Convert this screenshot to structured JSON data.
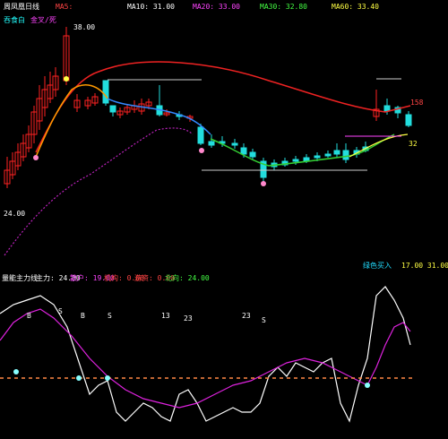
{
  "header": {
    "title": "周凤凰日线",
    "items": [
      {
        "text": "MA5:",
        "color": "#ff4444"
      },
      {
        "text": "MA10: 31.00",
        "color": "#ffffff"
      },
      {
        "text": "MA20: 33.00",
        "color": "#ff44ff"
      },
      {
        "text": "MA30: 32.80",
        "color": "#44ff44"
      },
      {
        "text": "MA60: 33.40",
        "color": "#ffff44"
      }
    ]
  },
  "sub_header": {
    "left_label": "吞食白",
    "badge": "金叉/死",
    "badge_color": "#ff44ff"
  },
  "price_labels": {
    "high": "38.00",
    "low": "24.00",
    "right_high": "158",
    "right_low": "32"
  },
  "indicator": {
    "title": "量能主力线",
    "items": [
      {
        "text": "主力: 24.00",
        "color": "#ffffff"
      },
      {
        "text": "散户: 19.00",
        "color": "#ff44ff"
      },
      {
        "text": "机构: 0.00",
        "color": "#ff4444"
      },
      {
        "text": "游资: 0.00",
        "color": "#ff4444"
      },
      {
        "text": "北向: 24.00",
        "color": "#44ff44"
      }
    ],
    "right_label": "绿色买入",
    "right_values": "17.00  31.00",
    "marks": [
      "B",
      "S",
      "B",
      "S",
      "13",
      "23",
      "23",
      "S"
    ]
  },
  "colors": {
    "up": "#ff2222",
    "down": "#22dddd",
    "ma_red": "#ee2222",
    "ma_orange": "#ff9900",
    "ma_green": "#33cc33",
    "ma_blue": "#3388ff",
    "dotted": "#bb22bb",
    "white_line": "#ffffff",
    "magenta": "#dd22dd",
    "dashed": "#ff8844"
  }
}
